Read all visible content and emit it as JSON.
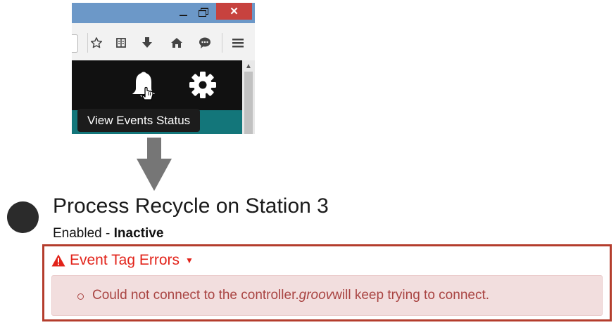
{
  "browser": {
    "window_controls": {
      "minimize_icon": "minimize-icon",
      "maximize_icon": "restore-icon",
      "close_label": "✕"
    },
    "toolbar_icons": [
      "star-icon",
      "reading-list-icon",
      "download-icon",
      "home-icon",
      "chat-icon",
      "menu-icon"
    ],
    "tooltip": "View Events Status",
    "nav_icons": [
      "bell-icon",
      "gear-icon"
    ]
  },
  "event": {
    "title": "Process Recycle on Station 3",
    "status_prefix": "Enabled - ",
    "status_value": "Inactive",
    "errors_header": "Event Tag Errors",
    "error_message": {
      "part1": "Could not connect to the controller. ",
      "product": "groov",
      "part2": " will keep trying to connect."
    }
  },
  "colors": {
    "navbar": "#111111",
    "teal": "#13767a",
    "error_red": "#e2231a",
    "error_text": "#a94442",
    "error_bg": "#f2dede",
    "highlight_border": "#b43d2d"
  }
}
